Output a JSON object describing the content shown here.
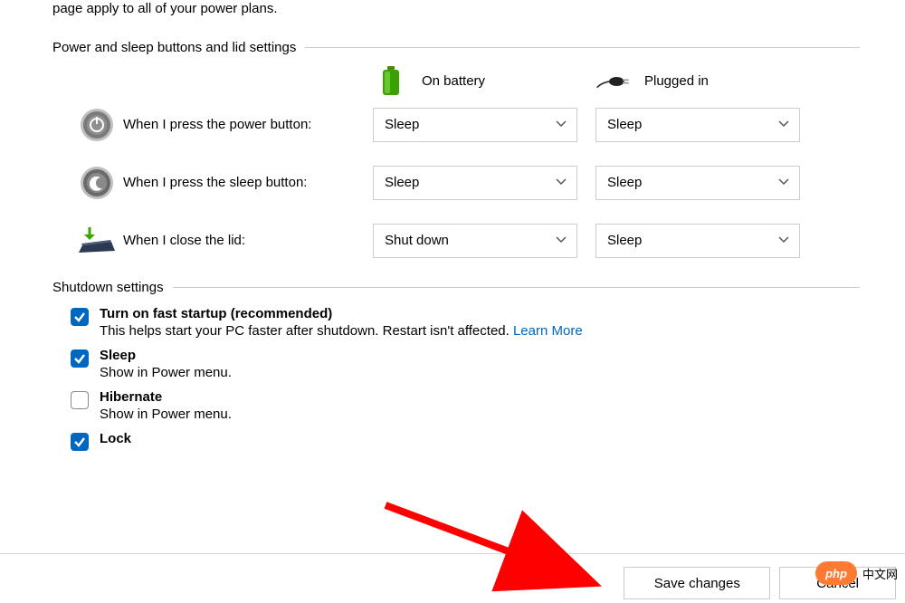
{
  "intro": "page apply to all of your power plans.",
  "sections": {
    "power_buttons": {
      "title": "Power and sleep buttons and lid settings",
      "headers": {
        "battery": "On battery",
        "plugged": "Plugged in"
      },
      "rows": [
        {
          "label": "When I press the power button:",
          "battery": "Sleep",
          "plugged": "Sleep"
        },
        {
          "label": "When I press the sleep button:",
          "battery": "Sleep",
          "plugged": "Sleep"
        },
        {
          "label": "When I close the lid:",
          "battery": "Shut down",
          "plugged": "Sleep"
        }
      ]
    },
    "shutdown": {
      "title": "Shutdown settings",
      "items": [
        {
          "checked": true,
          "title": "Turn on fast startup (recommended)",
          "desc": "This helps start your PC faster after shutdown. Restart isn't affected. ",
          "link": "Learn More"
        },
        {
          "checked": true,
          "title": "Sleep",
          "desc": "Show in Power menu."
        },
        {
          "checked": false,
          "title": "Hibernate",
          "desc": "Show in Power menu."
        },
        {
          "checked": true,
          "title": "Lock",
          "desc": ""
        }
      ]
    }
  },
  "footer": {
    "save": "Save changes",
    "cancel": "Cancel"
  },
  "watermark": {
    "pill": "php",
    "text": "中文网"
  }
}
